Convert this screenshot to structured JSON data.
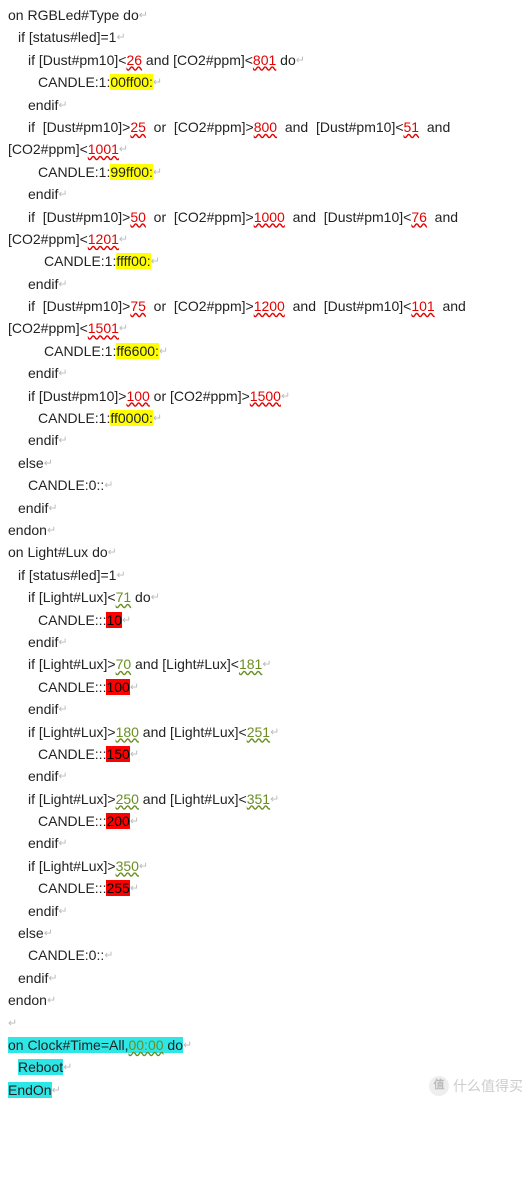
{
  "ret": "↵",
  "watermark": {
    "char": "值",
    "text": "什么值得买"
  },
  "lines": [
    {
      "cls": "line",
      "parts": [
        {
          "t": "on RGBLed#Type do"
        },
        {
          "b": "ret",
          "cls": "ret"
        }
      ]
    },
    {
      "cls": "line ind1",
      "parts": [
        {
          "t": "if [status#led]=1"
        },
        {
          "b": "ret",
          "cls": "ret"
        }
      ]
    },
    {
      "cls": "line ind2",
      "parts": [
        {
          "t": "if [Dust#pm10]<"
        },
        {
          "t": "26",
          "cls": "red"
        },
        {
          "t": " and [CO2#ppm]<"
        },
        {
          "t": "801",
          "cls": "red"
        },
        {
          "t": " do"
        },
        {
          "b": "ret",
          "cls": "ret"
        }
      ]
    },
    {
      "cls": "line ind3",
      "parts": [
        {
          "t": "CANDLE:1:"
        },
        {
          "t": "00ff00:",
          "cls": "yel"
        },
        {
          "b": "ret",
          "cls": "ret"
        }
      ]
    },
    {
      "cls": "line ind2",
      "parts": [
        {
          "t": "endif"
        },
        {
          "b": "ret",
          "cls": "ret"
        }
      ]
    },
    {
      "cls": "line ind2 just",
      "left": [
        {
          "t": "if  [Dust#pm10]>"
        },
        {
          "t": "25",
          "cls": "red"
        },
        {
          "t": "  or  [CO2#ppm]>"
        },
        {
          "t": "800",
          "cls": "red"
        },
        {
          "t": "  and  [Dust#pm10]<"
        },
        {
          "t": "51",
          "cls": "red"
        },
        {
          "t": "  and"
        }
      ],
      "right": []
    },
    {
      "cls": "line",
      "parts": [
        {
          "t": "[CO2#ppm]<"
        },
        {
          "t": "1001",
          "cls": "red"
        },
        {
          "b": "ret",
          "cls": "ret"
        }
      ]
    },
    {
      "cls": "line ind3",
      "parts": [
        {
          "t": "CANDLE:1:"
        },
        {
          "t": "99ff00:",
          "cls": "yel"
        },
        {
          "b": "ret",
          "cls": "ret"
        }
      ]
    },
    {
      "cls": "line ind2",
      "parts": [
        {
          "t": "endif"
        },
        {
          "b": "ret",
          "cls": "ret"
        }
      ]
    },
    {
      "cls": "line ind2 just",
      "left": [
        {
          "t": "if  [Dust#pm10]>"
        },
        {
          "t": "50",
          "cls": "red"
        },
        {
          "t": "  or  [CO2#ppm]>"
        },
        {
          "t": "1000",
          "cls": "red"
        },
        {
          "t": "  and  [Dust#pm10]<"
        },
        {
          "t": "76",
          "cls": "red"
        },
        {
          "t": "  and"
        }
      ],
      "right": []
    },
    {
      "cls": "line",
      "parts": [
        {
          "t": "[CO2#ppm]<"
        },
        {
          "t": "1201",
          "cls": "red"
        },
        {
          "b": "ret",
          "cls": "ret"
        }
      ]
    },
    {
      "cls": "line ind4",
      "parts": [
        {
          "t": "CANDLE:1:"
        },
        {
          "t": "ffff00:",
          "cls": "yel"
        },
        {
          "b": "ret",
          "cls": "ret"
        }
      ]
    },
    {
      "cls": "line ind2",
      "parts": [
        {
          "t": "endif"
        },
        {
          "b": "ret",
          "cls": "ret"
        }
      ]
    },
    {
      "cls": "line ind2 just",
      "left": [
        {
          "t": "if  [Dust#pm10]>"
        },
        {
          "t": "75",
          "cls": "red"
        },
        {
          "t": "  or  [CO2#ppm]>"
        },
        {
          "t": "1200",
          "cls": "red"
        },
        {
          "t": "  and  [Dust#pm10]<"
        },
        {
          "t": "101",
          "cls": "red"
        },
        {
          "t": "  and"
        }
      ],
      "right": []
    },
    {
      "cls": "line",
      "parts": [
        {
          "t": "[CO2#ppm]<"
        },
        {
          "t": "1501",
          "cls": "red"
        },
        {
          "b": "ret",
          "cls": "ret"
        }
      ]
    },
    {
      "cls": "line ind4",
      "parts": [
        {
          "t": "CANDLE:1:"
        },
        {
          "t": "ff6600:",
          "cls": "yel"
        },
        {
          "b": "ret",
          "cls": "ret"
        }
      ]
    },
    {
      "cls": "line ind2",
      "parts": [
        {
          "t": "endif"
        },
        {
          "b": "ret",
          "cls": "ret"
        }
      ]
    },
    {
      "cls": "line ind2",
      "parts": [
        {
          "t": "if [Dust#pm10]>"
        },
        {
          "t": "100",
          "cls": "red"
        },
        {
          "t": " or [CO2#ppm]>"
        },
        {
          "t": "1500",
          "cls": "red"
        },
        {
          "b": "ret",
          "cls": "ret"
        }
      ]
    },
    {
      "cls": "line ind3",
      "parts": [
        {
          "t": "CANDLE:1:"
        },
        {
          "t": "ff0000:",
          "cls": "yel"
        },
        {
          "b": "ret",
          "cls": "ret"
        }
      ]
    },
    {
      "cls": "line ind2",
      "parts": [
        {
          "t": "endif"
        },
        {
          "b": "ret",
          "cls": "ret"
        }
      ]
    },
    {
      "cls": "line ind1",
      "parts": [
        {
          "t": "else"
        },
        {
          "b": "ret",
          "cls": "ret"
        }
      ]
    },
    {
      "cls": "line ind2",
      "parts": [
        {
          "t": "CANDLE:0::"
        },
        {
          "b": "ret",
          "cls": "ret"
        }
      ]
    },
    {
      "cls": "line ind1",
      "parts": [
        {
          "t": "endif"
        },
        {
          "b": "ret",
          "cls": "ret"
        }
      ]
    },
    {
      "cls": "line",
      "parts": [
        {
          "t": "endon"
        },
        {
          "b": "ret",
          "cls": "ret"
        }
      ]
    },
    {
      "cls": "line",
      "parts": [
        {
          "t": "on Light#Lux do"
        },
        {
          "b": "ret",
          "cls": "ret"
        }
      ]
    },
    {
      "cls": "line ind1",
      "parts": [
        {
          "t": "if [status#led]=1"
        },
        {
          "b": "ret",
          "cls": "ret"
        }
      ]
    },
    {
      "cls": "line ind2",
      "parts": [
        {
          "t": "if [Light#Lux]<"
        },
        {
          "t": "71",
          "cls": "grn"
        },
        {
          "t": " do"
        },
        {
          "b": "ret",
          "cls": "ret"
        }
      ]
    },
    {
      "cls": "line ind3",
      "parts": [
        {
          "t": "CANDLE:::"
        },
        {
          "t": "10",
          "cls": "rbg"
        },
        {
          "b": "ret",
          "cls": "ret"
        }
      ]
    },
    {
      "cls": "line ind2",
      "parts": [
        {
          "t": "endif"
        },
        {
          "b": "ret",
          "cls": "ret"
        }
      ]
    },
    {
      "cls": "line ind2",
      "parts": [
        {
          "t": "if [Light#Lux]>"
        },
        {
          "t": "70",
          "cls": "grn"
        },
        {
          "t": " and [Light#Lux]<"
        },
        {
          "t": "181",
          "cls": "grn"
        },
        {
          "b": "ret",
          "cls": "ret"
        }
      ]
    },
    {
      "cls": "line ind3",
      "parts": [
        {
          "t": "CANDLE:::"
        },
        {
          "t": "100",
          "cls": "rbg"
        },
        {
          "b": "ret",
          "cls": "ret"
        }
      ]
    },
    {
      "cls": "line ind2",
      "parts": [
        {
          "t": "endif"
        },
        {
          "b": "ret",
          "cls": "ret"
        }
      ]
    },
    {
      "cls": "line ind2",
      "parts": [
        {
          "t": "if [Light#Lux]>"
        },
        {
          "t": "180",
          "cls": "grn"
        },
        {
          "t": " and [Light#Lux]<"
        },
        {
          "t": "251",
          "cls": "grn"
        },
        {
          "b": "ret",
          "cls": "ret"
        }
      ]
    },
    {
      "cls": "line ind3",
      "parts": [
        {
          "t": "CANDLE:::"
        },
        {
          "t": "150",
          "cls": "rbg"
        },
        {
          "b": "ret",
          "cls": "ret"
        }
      ]
    },
    {
      "cls": "line ind2",
      "parts": [
        {
          "t": "endif"
        },
        {
          "b": "ret",
          "cls": "ret"
        }
      ]
    },
    {
      "cls": "line ind2",
      "parts": [
        {
          "t": "if [Light#Lux]>"
        },
        {
          "t": "250",
          "cls": "grn"
        },
        {
          "t": " and [Light#Lux]<"
        },
        {
          "t": "351",
          "cls": "grn"
        },
        {
          "b": "ret",
          "cls": "ret"
        }
      ]
    },
    {
      "cls": "line ind3",
      "parts": [
        {
          "t": "CANDLE:::"
        },
        {
          "t": "200",
          "cls": "rbg"
        },
        {
          "b": "ret",
          "cls": "ret"
        }
      ]
    },
    {
      "cls": "line ind2",
      "parts": [
        {
          "t": "endif"
        },
        {
          "b": "ret",
          "cls": "ret"
        }
      ]
    },
    {
      "cls": "line ind2",
      "parts": [
        {
          "t": "if [Light#Lux]>"
        },
        {
          "t": "350",
          "cls": "grn"
        },
        {
          "b": "ret",
          "cls": "ret"
        }
      ]
    },
    {
      "cls": "line ind3",
      "parts": [
        {
          "t": "CANDLE:::"
        },
        {
          "t": "255",
          "cls": "rbg"
        },
        {
          "b": "ret",
          "cls": "ret"
        }
      ]
    },
    {
      "cls": "line ind2",
      "parts": [
        {
          "t": "endif"
        },
        {
          "b": "ret",
          "cls": "ret"
        }
      ]
    },
    {
      "cls": "line ind1",
      "parts": [
        {
          "t": "else"
        },
        {
          "b": "ret",
          "cls": "ret"
        }
      ]
    },
    {
      "cls": "line ind2",
      "parts": [
        {
          "t": "CANDLE:0::"
        },
        {
          "b": "ret",
          "cls": "ret"
        }
      ]
    },
    {
      "cls": "line ind1",
      "parts": [
        {
          "t": "endif"
        },
        {
          "b": "ret",
          "cls": "ret"
        }
      ]
    },
    {
      "cls": "line",
      "parts": [
        {
          "t": "endon"
        },
        {
          "b": "ret",
          "cls": "ret"
        }
      ]
    },
    {
      "cls": "line",
      "parts": [
        {
          "b": "ret",
          "cls": "ret"
        }
      ]
    },
    {
      "cls": "line",
      "parts": [
        {
          "t": "on Clock#Time=All,",
          "cls": "cyn"
        },
        {
          "t": "00:00",
          "cls": "cyn grn"
        },
        {
          "t": " do",
          "cls": "cyn"
        },
        {
          "b": "ret",
          "cls": "ret"
        }
      ]
    },
    {
      "cls": "line ind1",
      "parts": [
        {
          "t": "Reboot",
          "cls": "cyn"
        },
        {
          "b": "ret",
          "cls": "ret"
        }
      ]
    },
    {
      "cls": "line",
      "parts": [
        {
          "t": "EndOn",
          "cls": "cyn"
        },
        {
          "b": "ret",
          "cls": "ret"
        }
      ]
    }
  ]
}
